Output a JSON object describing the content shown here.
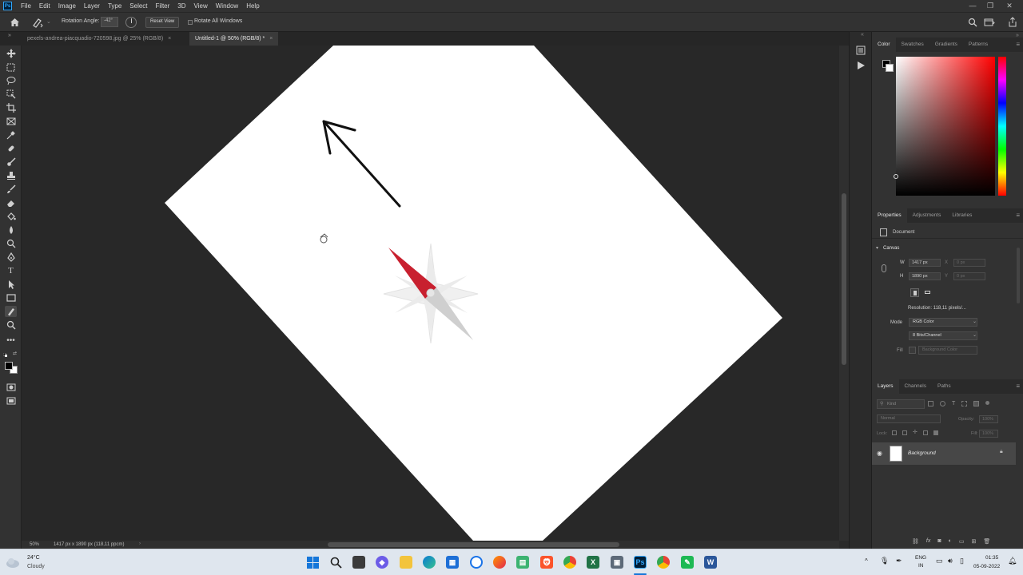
{
  "app": {
    "logo": "Ps",
    "menu": [
      "File",
      "Edit",
      "Image",
      "Layer",
      "Type",
      "Select",
      "Filter",
      "3D",
      "View",
      "Window",
      "Help"
    ],
    "window_controls": [
      "—",
      "❐",
      "✕"
    ]
  },
  "options_bar": {
    "rotation_label": "Rotation Angle:",
    "rotation_value": "-42°",
    "reset_view": "Reset View",
    "rotate_all_label": "Rotate All Windows"
  },
  "tabs": [
    {
      "label": "pexels-andrea-piacquadio-720598.jpg @ 25% (RGB/8)",
      "active": false
    },
    {
      "label": "Untitled-1 @ 50% (RGB/8) *",
      "active": true
    }
  ],
  "status": {
    "zoom": "50%",
    "doc_info": "1417 px x 1890 px (118,11 ppcm)"
  },
  "color_panel": {
    "tabs": [
      "Color",
      "Swatches",
      "Gradients",
      "Patterns"
    ],
    "hue_color": "#ff0000"
  },
  "properties_panel": {
    "tabs": [
      "Properties",
      "Adjustments",
      "Libraries"
    ],
    "doc_label": "Document",
    "section": "Canvas",
    "w_label": "W",
    "w_value": "1417 px",
    "h_label": "H",
    "h_value": "1890 px",
    "x_label": "X",
    "x_value": "0 px",
    "y_label": "Y",
    "y_value": "0 px",
    "resolution": "Resolution: 118,11 pixels/...",
    "mode_label": "Mode",
    "mode_value": "RGB Color",
    "depth_value": "8 Bits/Channel",
    "fill_label": "Fill",
    "fill_value": "Background Color"
  },
  "layers_panel": {
    "tabs": [
      "Layers",
      "Channels",
      "Paths"
    ],
    "kind_placeholder": "Kind",
    "blend_mode": "Normal",
    "opacity_label": "Opacity:",
    "opacity_value": "100%",
    "lock_label": "Lock:",
    "fill_label": "Fill:",
    "fill_value": "100%",
    "layers": [
      {
        "name": "Background",
        "visible": true,
        "locked": true
      }
    ]
  },
  "taskbar": {
    "weather_temp": "24°C",
    "weather_desc": "Cloudy",
    "lang_top": "ENG",
    "lang_bottom": "IN",
    "time": "01:35",
    "date": "05-09-2022"
  }
}
